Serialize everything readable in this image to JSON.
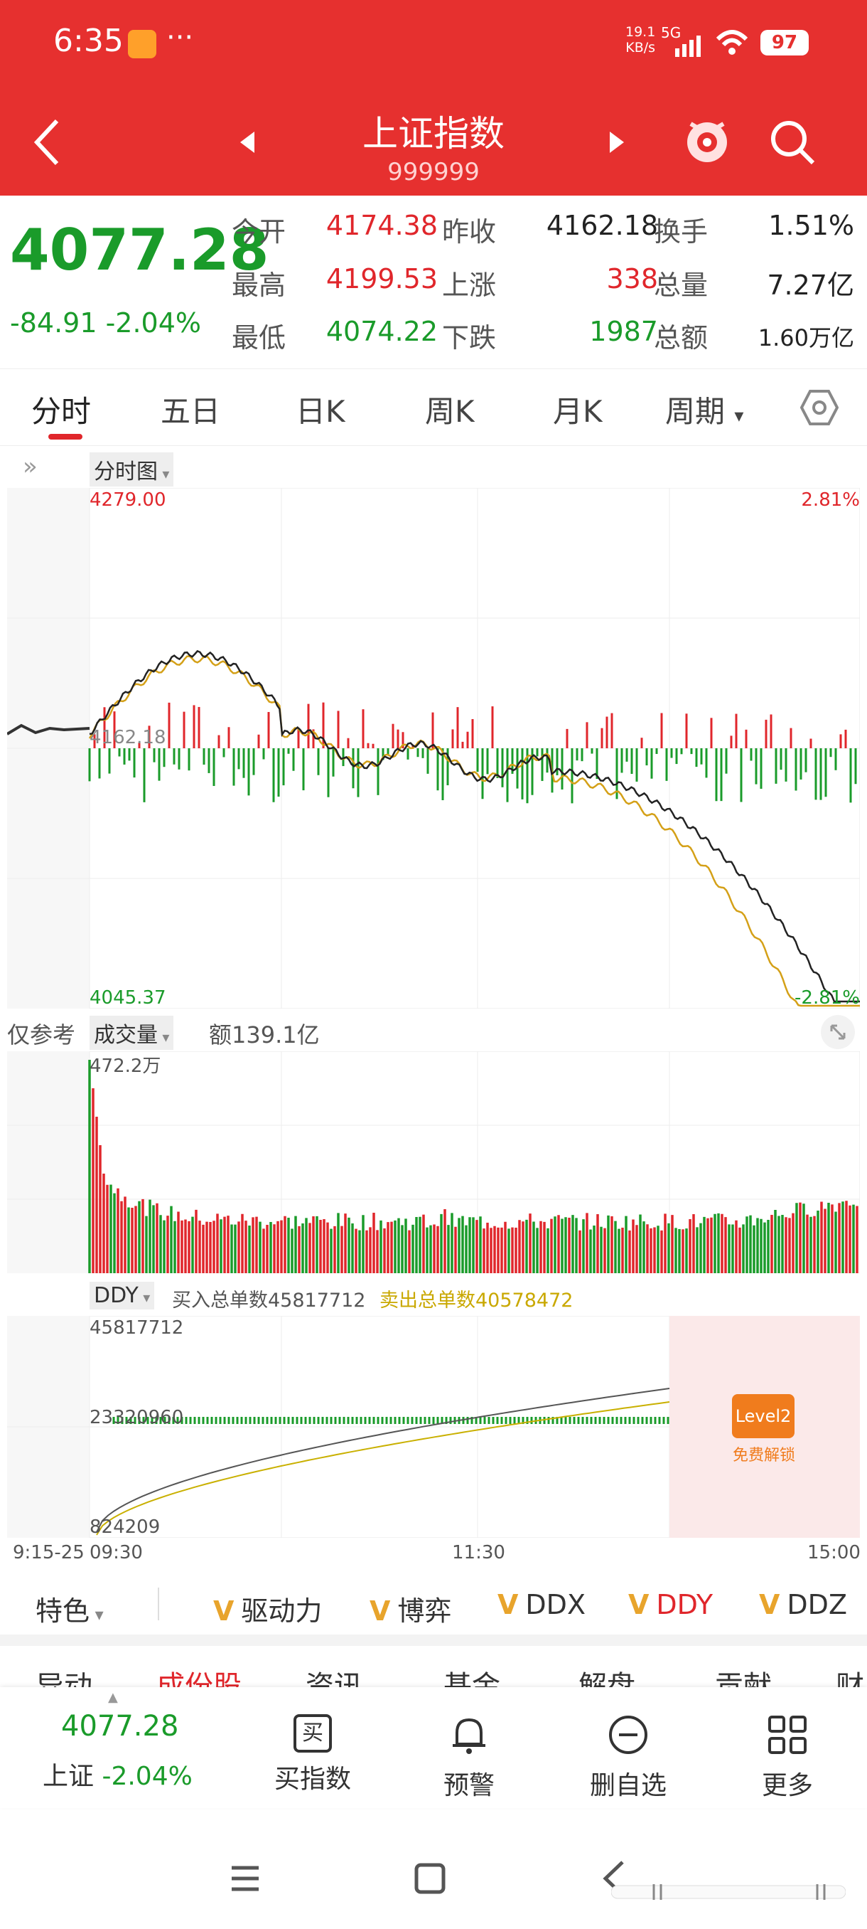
{
  "status": {
    "time": "6:35",
    "dots": "···",
    "net_speed_top": "19.1",
    "net_speed_bottom": "KB/s",
    "network": "5G",
    "battery": "97"
  },
  "header": {
    "title": "上证指数",
    "code": "999999"
  },
  "quote": {
    "price": "4077.28",
    "change": "-84.91",
    "change_pct": "-2.04%",
    "rows": [
      {
        "l1": "今开",
        "v1": "4174.38",
        "l2": "昨收",
        "v2": "4162.18",
        "l3": "换手",
        "v3": "1.51%"
      },
      {
        "l1": "最高",
        "v1": "4199.53",
        "l2": "上涨",
        "v2": "338",
        "l3": "总量",
        "v3": "7.27亿"
      },
      {
        "l1": "最低",
        "v1": "4074.22",
        "l2": "下跌",
        "v2": "1987",
        "l3": "总额",
        "v3": "1.60万亿"
      }
    ]
  },
  "tabs": [
    "分时",
    "五日",
    "日K",
    "周K",
    "月K",
    "周期"
  ],
  "chart_type_chip": "分时图",
  "intraday": {
    "top_price": "4279.00",
    "top_pct": "2.81%",
    "prev_close": "4162.18",
    "bottom_price": "4045.37",
    "bottom_pct": "-2.81%"
  },
  "volume": {
    "ref": "仅参考",
    "chip": "成交量",
    "amount": "额139.1亿",
    "max": "472.2万"
  },
  "ddy": {
    "chip": "DDY",
    "buy": "买入总单数45817712",
    "sell": "卖出总单数40578472",
    "top": "45817712",
    "mid": "23320960",
    "bottom": "824209"
  },
  "time_axis": {
    "pre": "9:15-25",
    "open": "09:30",
    "mid": "11:30",
    "close": "15:00"
  },
  "level2": {
    "badge": "Level2",
    "sub": "免费解锁"
  },
  "indicator_tabs": {
    "feature": "特色",
    "items": [
      "驱动力",
      "博弈",
      "DDX",
      "DDY",
      "DDZ"
    ]
  },
  "section_tabs": [
    "异动",
    "成份股",
    "资讯",
    "基金",
    "解盘",
    "贡献",
    "财"
  ],
  "bottom_nav": {
    "index_price": "4077.28",
    "index_name": "上证",
    "index_pct": "-2.04%",
    "items": [
      {
        "icon": "买",
        "label": "买指数"
      },
      {
        "label": "预警"
      },
      {
        "label": "删自选"
      },
      {
        "label": "更多"
      }
    ]
  },
  "colors": {
    "header_red": "#e6302f",
    "up_red": "#e0262b",
    "down_green": "#1a9b2a",
    "avg_line": "#d4a017"
  }
}
